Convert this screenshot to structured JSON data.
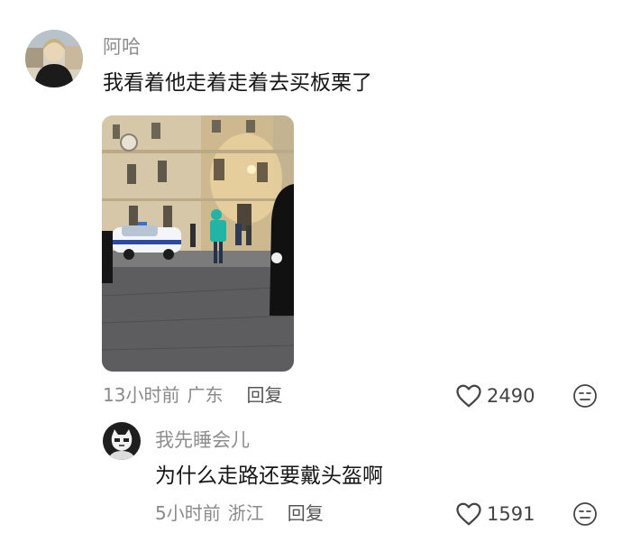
{
  "comment": {
    "username": "阿哈",
    "text": "我看着他走着走着去买板栗了",
    "time": "13小时前",
    "location": "广东",
    "reply_label": "回复",
    "likes": "2490",
    "avatar_icon": "user-avatar",
    "image_icon": "street-photo"
  },
  "reply": {
    "username": "我先睡会儿",
    "text": "为什么走路还要戴头盔啊",
    "time": "5小时前",
    "location": "浙江",
    "reply_label": "回复",
    "likes": "1591",
    "avatar_icon": "cat-avatar"
  },
  "colors": {
    "username": "#8e8e8e",
    "text": "#161616",
    "meta": "#8a8a8a",
    "icon": "#444444"
  }
}
